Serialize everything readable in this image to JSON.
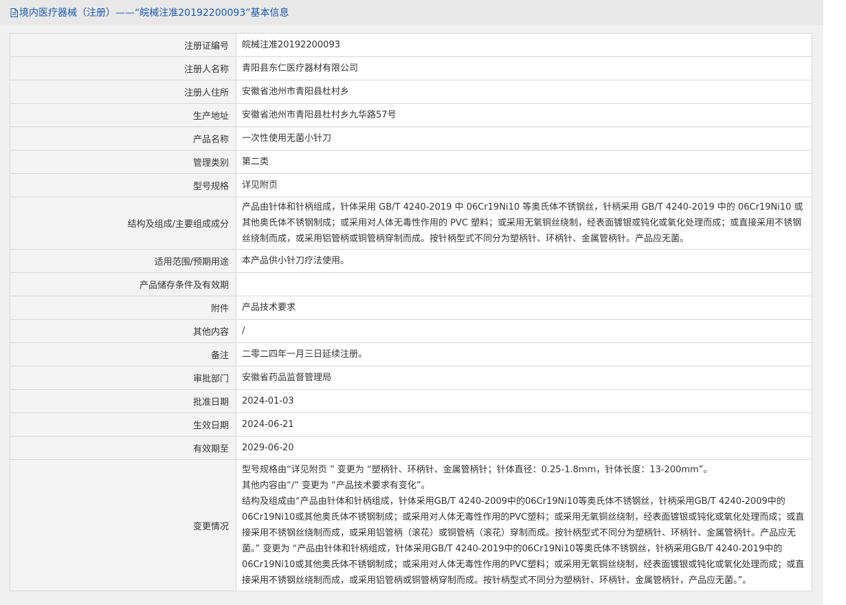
{
  "header": {
    "title": "境内医疗器械（注册）——“皖械注准20192200093”基本信息"
  },
  "rows": [
    {
      "label": "注册证编号",
      "value": "皖械注准20192200093"
    },
    {
      "label": "注册人名称",
      "value": "青阳县东仁医疗器材有限公司"
    },
    {
      "label": "注册人住所",
      "value": "安徽省池州市青阳县杜村乡"
    },
    {
      "label": "生产地址",
      "value": "安徽省池州市青阳县杜村乡九华路57号"
    },
    {
      "label": "产品名称",
      "value": "一次性使用无菌小针刀"
    },
    {
      "label": "管理类别",
      "value": "第二类"
    },
    {
      "label": "型号规格",
      "value": "详见附页"
    },
    {
      "label": "结构及组成/主要组成成分",
      "value": "产品由针体和针柄组成，针体采用 GB/T 4240-2019 中 06Cr19Ni10 等奥氏体不锈钢丝，针柄采用 GB/T 4240-2019 中的 06Cr19Ni10 或其他奥氏体不锈钢制成；或采用对人体无毒性作用的 PVC 塑料；或采用无氧铜丝绕制，经表面镀银或钝化或氧化处理而成；或直接采用不锈钢丝绕制而成，或采用铝管柄或铜管柄穿制而成。按针柄型式不同分为塑柄针、环柄针、金属管柄针。产品应无菌。"
    },
    {
      "label": "适用范围/预期用途",
      "value": "本产品供小针刀疗法使用。"
    },
    {
      "label": "产品储存条件及有效期",
      "value": ""
    },
    {
      "label": "附件",
      "value": "产品技术要求"
    },
    {
      "label": "其他内容",
      "value": "/"
    },
    {
      "label": "备注",
      "value": "二零二四年一月三日延续注册。"
    },
    {
      "label": "审批部门",
      "value": "安徽省药品监督管理局"
    },
    {
      "label": "批准日期",
      "value": "2024-01-03"
    },
    {
      "label": "生效日期",
      "value": "2024-06-21"
    },
    {
      "label": "有效期至",
      "value": "2029-06-20"
    }
  ],
  "changes": {
    "label": "变更情况",
    "lines": [
      "型号规格由“详见附页 ” 变更为 “塑柄针、环柄针、金属管柄针；针体直径：0.25-1.8mm，针体长度：13-200mm”。",
      "其他内容由“/” 变更为 “产品技术要求有变化”。",
      "结构及组成由“产品由针体和针柄组成，针体采用GB/T 4240-2009中的06Cr19Ni10等奥氏体不锈钢丝，针柄采用GB/T 4240-2009中的06Cr19Ni10或其他奥氏体不锈钢制成；或采用对人体无毒性作用的PVC塑料；或采用无氧铜丝绕制，经表面镀银或钝化或氧化处理而成；或直接采用不锈钢丝绕制而成，或采用铝管柄（滚花）或铜管柄（滚花）穿制而成。按针柄型式不同分为塑柄针、环柄针、金属管柄针。产品应无菌。” 变更为 “产品由针体和针柄组成，针体采用GB/T 4240-2019中的06Cr19Ni10等奥氏体不锈钢丝，针柄采用GB/T 4240-2019中的06Cr19Ni10或其他奥氏体不锈钢制成；或采用对人体无毒性作用的PVC塑料；或采用无氧铜丝绕制，经表面镀银或钝化或氧化处理而成；或直接采用不锈钢丝绕制而成，或采用铝管柄或铜管柄穿制而成。按针柄型式不同分为塑柄针、环柄针、金属管柄针，产品应无菌。”。"
    ]
  }
}
